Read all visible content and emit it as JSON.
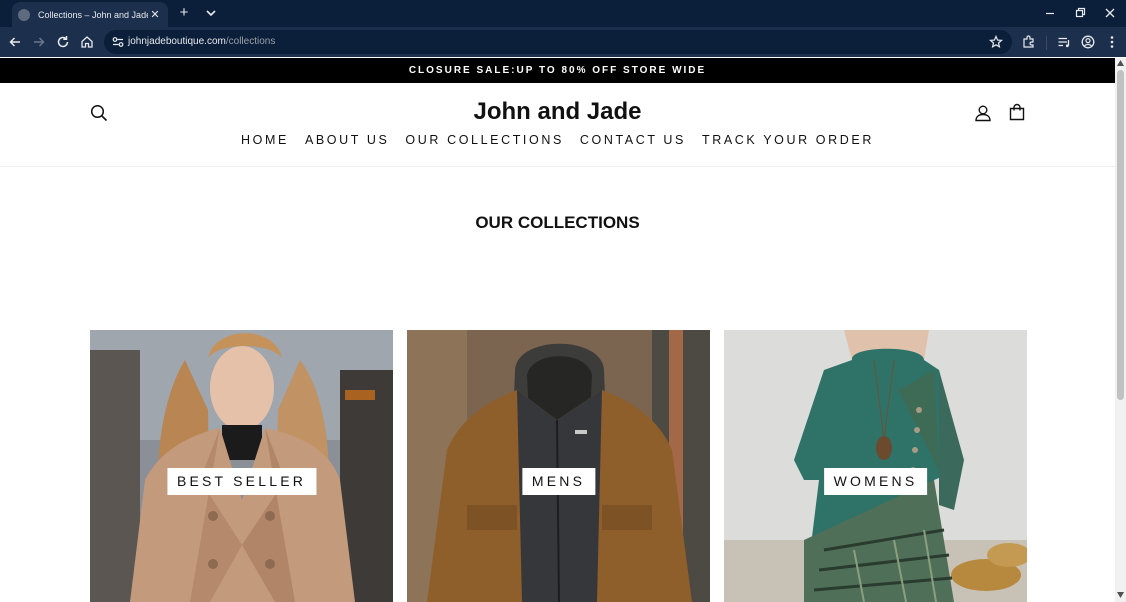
{
  "browser": {
    "tab_title": "Collections – John and Jade",
    "url_host": "johnjadeboutique.com",
    "url_path": "/collections",
    "icons": [
      "globe-icon",
      "close-icon",
      "plus-icon",
      "chevron-down-icon",
      "minimize-icon",
      "restore-icon",
      "back-icon",
      "forward-icon",
      "reload-icon",
      "home-icon",
      "site-settings-icon",
      "star-icon",
      "extensions-icon",
      "media-icon",
      "profile-icon",
      "more-icon"
    ]
  },
  "announcement": {
    "text": "CLOSURE SALE:UP TO 80% OFF STORE WIDE"
  },
  "header": {
    "brand": "John and Jade",
    "icons": [
      "search-icon",
      "user-icon",
      "bag-icon"
    ]
  },
  "nav": {
    "items": [
      {
        "label": "HOME"
      },
      {
        "label": "ABOUT US"
      },
      {
        "label": "OUR COLLECTIONS"
      },
      {
        "label": "CONTACT US"
      },
      {
        "label": "TRACK YOUR ORDER"
      }
    ]
  },
  "main": {
    "title": "OUR COLLECTIONS",
    "collections": [
      {
        "label": "BEST SELLER"
      },
      {
        "label": "MENS"
      },
      {
        "label": "WOMENS"
      }
    ]
  },
  "colors": {
    "browser_frame": "#0b1f3a",
    "browser_toolbar": "#1c2f4d",
    "announcement_bg": "#000000",
    "text": "#111111"
  }
}
